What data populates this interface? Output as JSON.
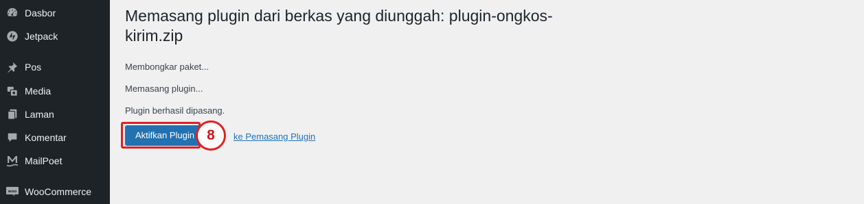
{
  "sidebar": {
    "items": [
      {
        "label": "Dasbor",
        "icon": "dashboard-icon"
      },
      {
        "label": "Jetpack",
        "icon": "jetpack-icon"
      },
      {
        "label": "Pos",
        "icon": "pin-icon"
      },
      {
        "label": "Media",
        "icon": "media-icon"
      },
      {
        "label": "Laman",
        "icon": "page-icon"
      },
      {
        "label": "Komentar",
        "icon": "comment-icon"
      },
      {
        "label": "MailPoet",
        "icon": "mailpoet-icon"
      },
      {
        "label": "WooCommerce",
        "icon": "woocommerce-icon"
      }
    ]
  },
  "main": {
    "title": "Memasang plugin dari berkas yang diunggah: plugin-ongkos-kirim.zip",
    "messages": [
      "Membongkar paket...",
      "Memasang plugin...",
      "Plugin berhasil dipasang."
    ],
    "activate_label": "Aktifkan Plugin",
    "back_link_label": "ke Pemasang Plugin"
  },
  "annotation": {
    "step": "8",
    "color": "#e02020"
  },
  "colors": {
    "sidebar_bg": "#1d2327",
    "page_bg": "#f0f0f1",
    "primary": "#2271b1"
  }
}
